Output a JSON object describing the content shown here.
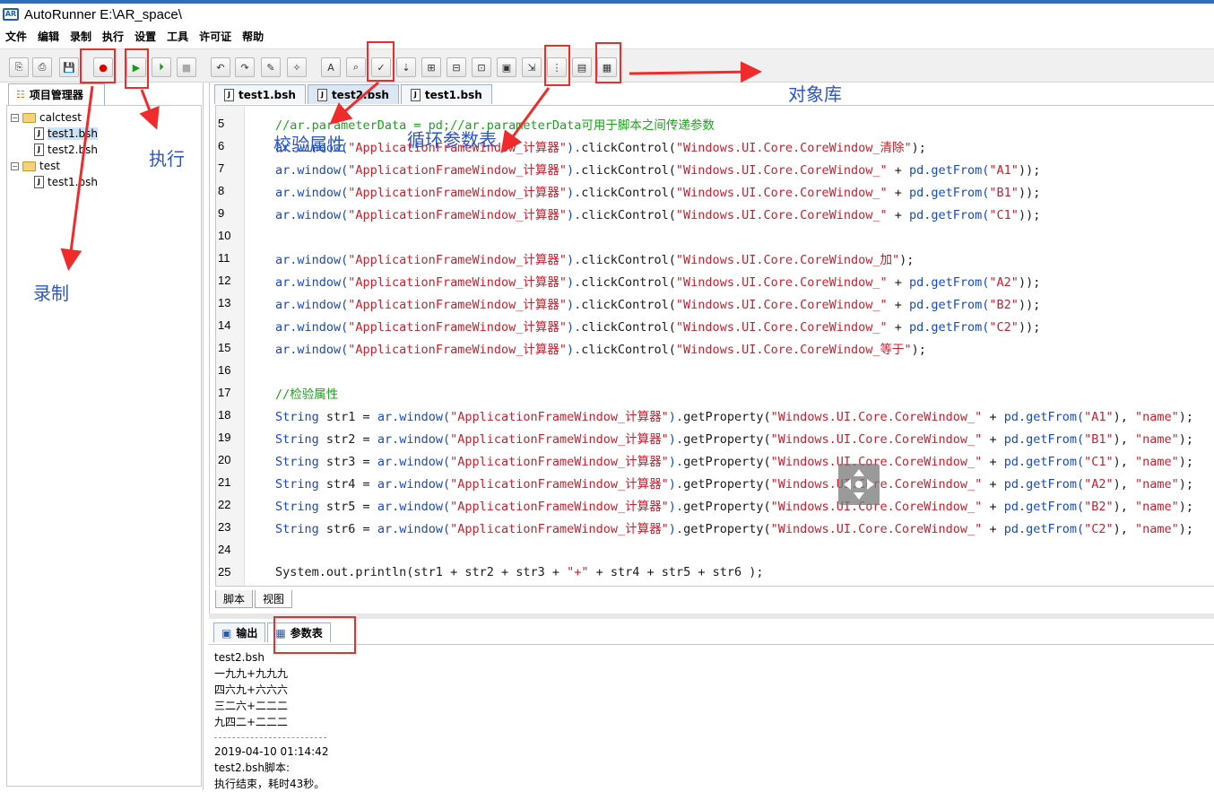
{
  "window": {
    "title": "AutoRunner  E:\\AR_space\\",
    "icon_text": "AR"
  },
  "menu": [
    "文件",
    "编辑",
    "录制",
    "执行",
    "设置",
    "工具",
    "许可证",
    "帮助"
  ],
  "toolbar": {
    "buttons": [
      {
        "name": "new-project-button",
        "glyph": "⎘"
      },
      {
        "name": "new-script-button",
        "glyph": "⎙"
      },
      {
        "name": "save-button",
        "glyph": "💾"
      },
      {
        "name": "record-button",
        "glyph": "●"
      },
      {
        "name": "run-button",
        "glyph": "▶"
      },
      {
        "name": "step-run-button",
        "glyph": "⏵"
      },
      {
        "name": "stop-button",
        "glyph": "■"
      },
      {
        "name": "undo-button",
        "glyph": "↶"
      },
      {
        "name": "redo-button",
        "glyph": "↷"
      },
      {
        "name": "tool-1-button",
        "glyph": "✎"
      },
      {
        "name": "tool-2-button",
        "glyph": "✧"
      },
      {
        "name": "font-button",
        "glyph": "A"
      },
      {
        "name": "find-button",
        "glyph": "⌕"
      },
      {
        "name": "verify-property-button",
        "glyph": "✓"
      },
      {
        "name": "tool-3-button",
        "glyph": "⇣"
      },
      {
        "name": "tool-4-button",
        "glyph": "⊞"
      },
      {
        "name": "tool-5-button",
        "glyph": "⊟"
      },
      {
        "name": "tool-6-button",
        "glyph": "⊡"
      },
      {
        "name": "tool-7-button",
        "glyph": "▣"
      },
      {
        "name": "tool-8-button",
        "glyph": "⇲"
      },
      {
        "name": "loop-parameter-button",
        "glyph": "⋮"
      },
      {
        "name": "tool-9-button",
        "glyph": "▤"
      },
      {
        "name": "object-library-button",
        "glyph": "▦"
      }
    ]
  },
  "project_panel": {
    "tab_label": "项目管理器",
    "tree": [
      {
        "label": "calctest",
        "type": "folder",
        "toggle": "−"
      },
      {
        "label": "test1.bsh",
        "type": "file",
        "selected": true
      },
      {
        "label": "test2.bsh",
        "type": "file"
      },
      {
        "label": "test",
        "type": "folder",
        "toggle": "−"
      },
      {
        "label": "test1.bsh",
        "type": "file"
      }
    ]
  },
  "editor": {
    "tabs": [
      "test1.bsh",
      "test2.bsh",
      "test1.bsh"
    ],
    "active_tab": 1,
    "subtabs": [
      "脚本",
      "视图"
    ],
    "lines": [
      {
        "n": "5",
        "parts": [
          [
            "cmt",
            "//ar.parameterData = pd;//ar.parameterData可用于脚本之间传递参数"
          ]
        ]
      },
      {
        "n": "6",
        "parts": [
          [
            "kw",
            "ar.window("
          ],
          [
            "str",
            "\"ApplicationFrameWindow_计算器\""
          ],
          [
            "kw",
            ")."
          ],
          [
            "",
            "clickControl("
          ],
          [
            "str",
            "\"Windows.UI.Core.CoreWindow_清除\""
          ],
          [
            "",
            ");"
          ]
        ]
      },
      {
        "n": "7",
        "parts": [
          [
            "kw",
            "ar.window("
          ],
          [
            "str",
            "\"ApplicationFrameWindow_计算器\""
          ],
          [
            "kw",
            ")."
          ],
          [
            "",
            "clickControl("
          ],
          [
            "str",
            "\"Windows.UI.Core.CoreWindow_\""
          ],
          [
            "",
            " + "
          ],
          [
            "kw",
            "pd.getFrom("
          ],
          [
            "str",
            "\"A1\""
          ],
          [
            "",
            "));"
          ]
        ]
      },
      {
        "n": "8",
        "parts": [
          [
            "kw",
            "ar.window("
          ],
          [
            "str",
            "\"ApplicationFrameWindow_计算器\""
          ],
          [
            "kw",
            ")."
          ],
          [
            "",
            "clickControl("
          ],
          [
            "str",
            "\"Windows.UI.Core.CoreWindow_\""
          ],
          [
            "",
            " + "
          ],
          [
            "kw",
            "pd.getFrom("
          ],
          [
            "str",
            "\"B1\""
          ],
          [
            "",
            "));"
          ]
        ]
      },
      {
        "n": "9",
        "parts": [
          [
            "kw",
            "ar.window("
          ],
          [
            "str",
            "\"ApplicationFrameWindow_计算器\""
          ],
          [
            "kw",
            ")."
          ],
          [
            "",
            "clickControl("
          ],
          [
            "str",
            "\"Windows.UI.Core.CoreWindow_\""
          ],
          [
            "",
            " + "
          ],
          [
            "kw",
            "pd.getFrom("
          ],
          [
            "str",
            "\"C1\""
          ],
          [
            "",
            "));"
          ]
        ]
      },
      {
        "n": "10",
        "parts": []
      },
      {
        "n": "11",
        "parts": [
          [
            "kw",
            "ar.window("
          ],
          [
            "str",
            "\"ApplicationFrameWindow_计算器\""
          ],
          [
            "kw",
            ")."
          ],
          [
            "",
            "clickControl("
          ],
          [
            "str",
            "\"Windows.UI.Core.CoreWindow_加\""
          ],
          [
            "",
            ");"
          ]
        ]
      },
      {
        "n": "12",
        "parts": [
          [
            "kw",
            "ar.window("
          ],
          [
            "str",
            "\"ApplicationFrameWindow_计算器\""
          ],
          [
            "kw",
            ")."
          ],
          [
            "",
            "clickControl("
          ],
          [
            "str",
            "\"Windows.UI.Core.CoreWindow_\""
          ],
          [
            "",
            " + "
          ],
          [
            "kw",
            "pd.getFrom("
          ],
          [
            "str",
            "\"A2\""
          ],
          [
            "",
            "));"
          ]
        ]
      },
      {
        "n": "13",
        "parts": [
          [
            "kw",
            "ar.window("
          ],
          [
            "str",
            "\"ApplicationFrameWindow_计算器\""
          ],
          [
            "kw",
            ")."
          ],
          [
            "",
            "clickControl("
          ],
          [
            "str",
            "\"Windows.UI.Core.CoreWindow_\""
          ],
          [
            "",
            " + "
          ],
          [
            "kw",
            "pd.getFrom("
          ],
          [
            "str",
            "\"B2\""
          ],
          [
            "",
            "));"
          ]
        ]
      },
      {
        "n": "14",
        "parts": [
          [
            "kw",
            "ar.window("
          ],
          [
            "str",
            "\"ApplicationFrameWindow_计算器\""
          ],
          [
            "kw",
            ")."
          ],
          [
            "",
            "clickControl("
          ],
          [
            "str",
            "\"Windows.UI.Core.CoreWindow_\""
          ],
          [
            "",
            " + "
          ],
          [
            "kw",
            "pd.getFrom("
          ],
          [
            "str",
            "\"C2\""
          ],
          [
            "",
            "));"
          ]
        ]
      },
      {
        "n": "15",
        "parts": [
          [
            "kw",
            "ar.window("
          ],
          [
            "str",
            "\"ApplicationFrameWindow_计算器\""
          ],
          [
            "kw",
            ")."
          ],
          [
            "",
            "clickControl("
          ],
          [
            "str",
            "\"Windows.UI.Core.CoreWindow_等于\""
          ],
          [
            "",
            ");"
          ]
        ]
      },
      {
        "n": "16",
        "parts": []
      },
      {
        "n": "17",
        "parts": [
          [
            "cmt",
            "//检验属性"
          ]
        ]
      },
      {
        "n": "18",
        "parts": [
          [
            "kw",
            "String"
          ],
          [
            "",
            " str1 = "
          ],
          [
            "kw",
            "ar.window("
          ],
          [
            "str",
            "\"ApplicationFrameWindow_计算器\""
          ],
          [
            "kw",
            ")."
          ],
          [
            "",
            "getProperty("
          ],
          [
            "str",
            "\"Windows.UI.Core.CoreWindow_\""
          ],
          [
            "",
            " + "
          ],
          [
            "kw",
            "pd.getFrom("
          ],
          [
            "str",
            "\"A1\""
          ],
          [
            "",
            "), "
          ],
          [
            "str",
            "\"name\""
          ],
          [
            "",
            ");"
          ]
        ]
      },
      {
        "n": "19",
        "parts": [
          [
            "kw",
            "String"
          ],
          [
            "",
            " str2 = "
          ],
          [
            "kw",
            "ar.window("
          ],
          [
            "str",
            "\"ApplicationFrameWindow_计算器\""
          ],
          [
            "kw",
            ")."
          ],
          [
            "",
            "getProperty("
          ],
          [
            "str",
            "\"Windows.UI.Core.CoreWindow_\""
          ],
          [
            "",
            " + "
          ],
          [
            "kw",
            "pd.getFrom("
          ],
          [
            "str",
            "\"B1\""
          ],
          [
            "",
            "), "
          ],
          [
            "str",
            "\"name\""
          ],
          [
            "",
            ");"
          ]
        ]
      },
      {
        "n": "20",
        "parts": [
          [
            "kw",
            "String"
          ],
          [
            "",
            " str3 = "
          ],
          [
            "kw",
            "ar.window("
          ],
          [
            "str",
            "\"ApplicationFrameWindow_计算器\""
          ],
          [
            "kw",
            ")."
          ],
          [
            "",
            "getProperty("
          ],
          [
            "str",
            "\"Windows.UI.Core.CoreWindow_\""
          ],
          [
            "",
            " + "
          ],
          [
            "kw",
            "pd.getFrom("
          ],
          [
            "str",
            "\"C1\""
          ],
          [
            "",
            "), "
          ],
          [
            "str",
            "\"name\""
          ],
          [
            "",
            ");"
          ]
        ]
      },
      {
        "n": "21",
        "parts": [
          [
            "kw",
            "String"
          ],
          [
            "",
            " str4 = "
          ],
          [
            "kw",
            "ar.window("
          ],
          [
            "str",
            "\"ApplicationFrameWindow_计算器\""
          ],
          [
            "kw",
            ")."
          ],
          [
            "",
            "getProperty("
          ],
          [
            "str",
            "\"Windows.UI.Core.CoreWindow_\""
          ],
          [
            "",
            " + "
          ],
          [
            "kw",
            "pd.getFrom("
          ],
          [
            "str",
            "\"A2\""
          ],
          [
            "",
            "), "
          ],
          [
            "str",
            "\"name\""
          ],
          [
            "",
            ");"
          ]
        ]
      },
      {
        "n": "22",
        "parts": [
          [
            "kw",
            "String"
          ],
          [
            "",
            " str5 = "
          ],
          [
            "kw",
            "ar.window("
          ],
          [
            "str",
            "\"ApplicationFrameWindow_计算器\""
          ],
          [
            "kw",
            ")."
          ],
          [
            "",
            "getProperty("
          ],
          [
            "str",
            "\"Windows.UI.Core.CoreWindow_\""
          ],
          [
            "",
            " + "
          ],
          [
            "kw",
            "pd.getFrom("
          ],
          [
            "str",
            "\"B2\""
          ],
          [
            "",
            "), "
          ],
          [
            "str",
            "\"name\""
          ],
          [
            "",
            ");"
          ]
        ]
      },
      {
        "n": "23",
        "parts": [
          [
            "kw",
            "String"
          ],
          [
            "",
            " str6 = "
          ],
          [
            "kw",
            "ar.window("
          ],
          [
            "str",
            "\"ApplicationFrameWindow_计算器\""
          ],
          [
            "kw",
            ")."
          ],
          [
            "",
            "getProperty("
          ],
          [
            "str",
            "\"Windows.UI.Core.CoreWindow_\""
          ],
          [
            "",
            " + "
          ],
          [
            "kw",
            "pd.getFrom("
          ],
          [
            "str",
            "\"C2\""
          ],
          [
            "",
            "), "
          ],
          [
            "str",
            "\"name\""
          ],
          [
            "",
            ");"
          ]
        ]
      },
      {
        "n": "24",
        "parts": []
      },
      {
        "n": "25",
        "parts": [
          [
            "",
            "System.out.println(str1 + str2 + str3 + "
          ],
          [
            "str",
            "\"+\""
          ],
          [
            "",
            " + str4 + str5 + str6 );"
          ]
        ]
      }
    ]
  },
  "bottom_panel": {
    "tabs": [
      "输出",
      "参数表"
    ],
    "output_lines_top": [
      "test2.bsh",
      "一九九+九九九",
      "四六九+六六六",
      "三二六+二二二",
      "九四二+二二二"
    ],
    "output_lines_bottom": [
      "2019-04-10 01:14:42",
      "test2.bsh脚本:",
      "执行结束，耗时43秒。"
    ]
  },
  "annotations": {
    "record": "录制",
    "run": "执行",
    "verify_property": "校验属性",
    "loop_parameter_table": "循环参数表",
    "object_library": "对象库"
  },
  "colors": {
    "annotation_red": "#ef2b2b",
    "annotation_blue": "#2b56c8",
    "keyword": "#1848c8",
    "string": "#c8202e",
    "comment": "#1aa41a"
  }
}
